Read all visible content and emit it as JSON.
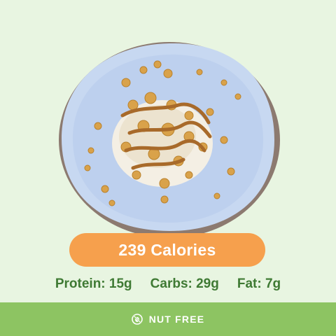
{
  "calories": {
    "label": "239 Calories"
  },
  "macros": {
    "protein": "Protein: 15g",
    "carbs": "Carbs: 29g",
    "fat": "Fat: 7g"
  },
  "footer": {
    "icon": "nut-free-icon",
    "label": "NUT FREE"
  },
  "colors": {
    "background": "#e8f5e1",
    "pill": "#f6a04d",
    "macro_text": "#3f7a34",
    "footer_bar": "#8dc462",
    "plate": "#bfd3f0"
  }
}
